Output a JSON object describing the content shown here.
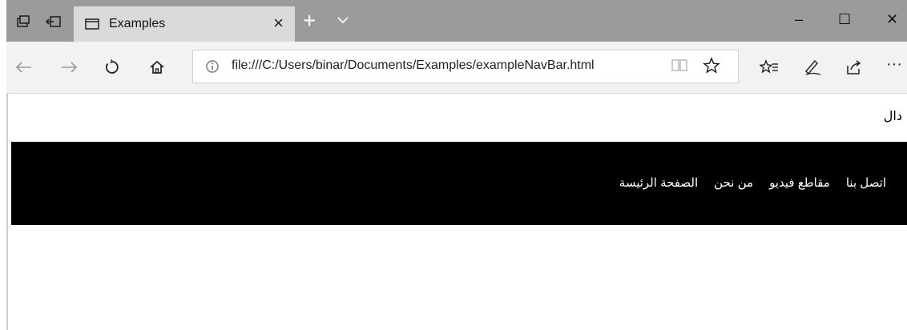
{
  "tab": {
    "title": "Examples",
    "close": "×"
  },
  "tabbar": {
    "new_tab": "+"
  },
  "window": {
    "minimize": "–",
    "maximize": "☐",
    "close": "✕"
  },
  "address_bar": {
    "url": "file:///C:/Users/binar/Documents/Examples/exampleNavBar.html"
  },
  "toolbar": {
    "more": "···"
  },
  "page": {
    "top_text": "دال",
    "nav_links": [
      "الصفحة الرئيسة",
      "من نحن",
      "مقاطع فيديو",
      "اتصل بنا"
    ]
  }
}
